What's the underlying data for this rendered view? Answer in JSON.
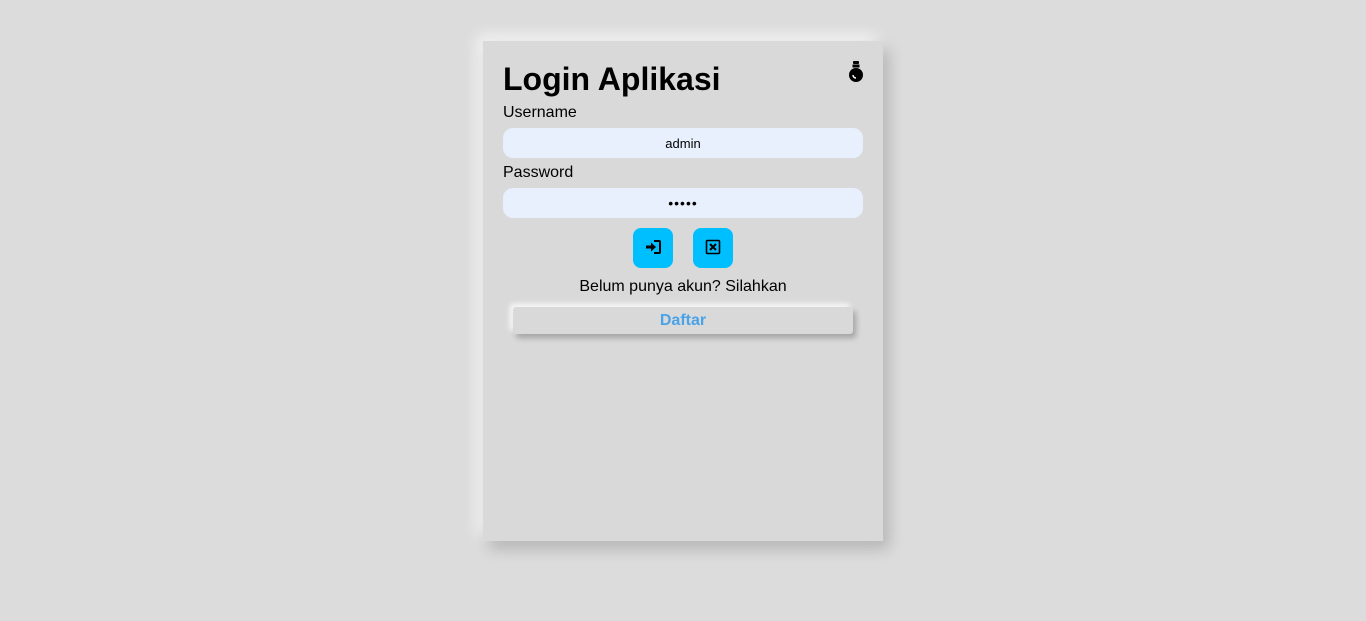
{
  "title": "Login Aplikasi",
  "theme_toggle_icon": "lightbulb-icon",
  "username": {
    "label": "Username",
    "value": "admin"
  },
  "password": {
    "label": "Password",
    "value": "•••••"
  },
  "buttons": {
    "login_icon": "sign-in-icon",
    "clear_icon": "close-box-icon"
  },
  "register": {
    "prompt": "Belum punya akun? Silahkan",
    "button_label": "Daftar"
  },
  "colors": {
    "accent": "#00bfff",
    "link": "#4aa3e8",
    "input_bg": "#e8f0fe",
    "card_bg": "#d9d9d9",
    "page_bg": "#dcdcdc"
  }
}
